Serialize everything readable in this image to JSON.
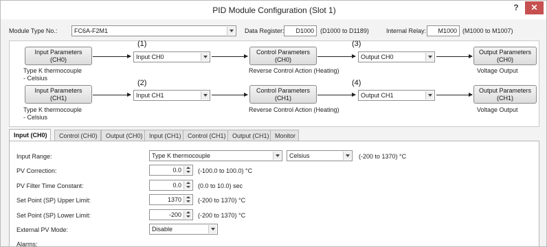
{
  "window": {
    "title": "PID Module Configuration (Slot 1)",
    "help": "?",
    "close": "✕"
  },
  "header": {
    "module_type_label": "Module Type No.:",
    "module_type_value": "FC6A-F2M1",
    "data_register_label": "Data Register:",
    "data_register_value": "D1000",
    "data_register_range": "(D1000 to D1189)",
    "internal_relay_label": "Internal Relay:",
    "internal_relay_value": "M1000",
    "internal_relay_range": "(M1000 to M1007)"
  },
  "diagram": {
    "ch0": {
      "input_params": [
        "Input Parameters",
        "(CH0)"
      ],
      "input_desc": [
        "Type K thermocouple",
        "- Celsius"
      ],
      "num1": "(1)",
      "input_select": "Input CH0",
      "control_params": [
        "Control Parameters",
        "(CH0)"
      ],
      "control_desc": "Reverse Control Action (Heating)",
      "num3": "(3)",
      "output_select": "Output CH0",
      "output_params": [
        "Output Parameters",
        "(CH0)"
      ],
      "output_desc": "Voltage Output"
    },
    "ch1": {
      "input_params": [
        "Input Parameters",
        "(CH1)"
      ],
      "input_desc": [
        "Type K thermocouple",
        "- Celsius"
      ],
      "num2": "(2)",
      "input_select": "Input CH1",
      "control_params": [
        "Control Parameters",
        "(CH1)"
      ],
      "control_desc": "Reverse Control Action (Heating)",
      "num4": "(4)",
      "output_select": "Output CH1",
      "output_params": [
        "Output Parameters",
        "(CH1)"
      ],
      "output_desc": "Voltage Output"
    }
  },
  "tabs": [
    "Input (CH0)",
    "Control (CH0)",
    "Output (CH0)",
    "Input (CH1)",
    "Control (CH1)",
    "Output (CH1)",
    "Monitor"
  ],
  "form": {
    "input_range_label": "Input Range:",
    "input_range_value": "Type K thermocouple",
    "unit_value": "Celsius",
    "input_range_hint": "(-200 to 1370) °C",
    "pv_correction_label": "PV Correction:",
    "pv_correction_value": "0.0",
    "pv_correction_hint": "(-100.0 to 100.0) °C",
    "pv_filter_label": "PV Filter Time Constant:",
    "pv_filter_value": "0.0",
    "pv_filter_hint": "(0.0 to 10.0) sec",
    "sp_upper_label": "Set Point (SP) Upper Limit:",
    "sp_upper_value": "1370",
    "sp_upper_hint": "(-200 to 1370) °C",
    "sp_lower_label": "Set Point (SP) Lower Limit:",
    "sp_lower_value": "-200",
    "sp_lower_hint": "(-200 to 1370) °C",
    "ext_pv_label": "External PV Mode:",
    "ext_pv_value": "Disable",
    "alarms_label": "Alarms:"
  }
}
